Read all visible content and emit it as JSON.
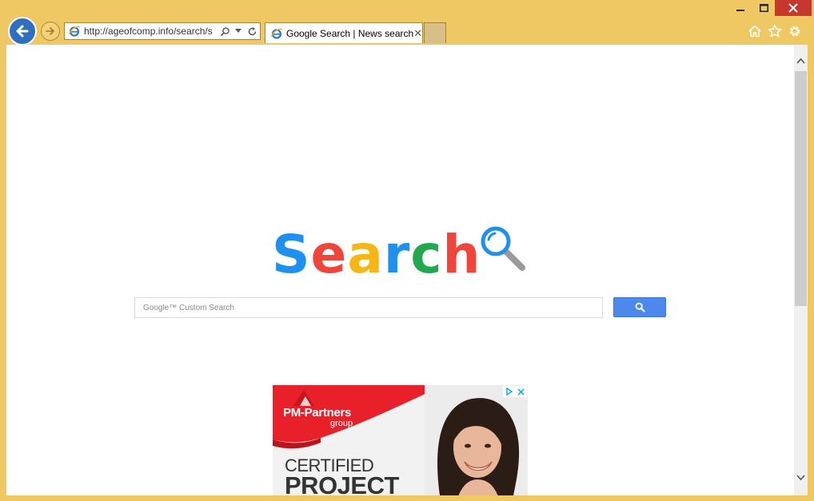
{
  "browser": {
    "url": "http://ageofcomp.info/search/s",
    "tab_title": "Google Search | News search",
    "tab_close": "✕"
  },
  "page": {
    "logo_letters": [
      {
        "char": "S",
        "color": "#1e90f0"
      },
      {
        "char": "e",
        "color": "#f0453a"
      },
      {
        "char": "a",
        "color": "#f8b616"
      },
      {
        "char": "r",
        "color": "#1e90f0"
      },
      {
        "char": "c",
        "color": "#22a84f"
      },
      {
        "char": "h",
        "color": "#f0453a"
      }
    ],
    "search_placeholder": "Google™ Custom Search"
  },
  "ad": {
    "brand": "PM-Partners",
    "brand_sub": "group",
    "headline_1": "CERTIFIED",
    "headline_2": "PROJECT"
  },
  "colors": {
    "chrome": "#f0c863",
    "search_button": "#4d88ec",
    "close_button": "#c7372f"
  }
}
